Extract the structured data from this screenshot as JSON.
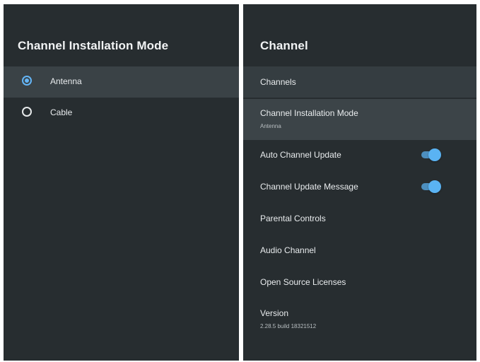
{
  "left_panel": {
    "title": "Channel Installation Mode",
    "options": [
      {
        "label": "Antenna",
        "selected": true
      },
      {
        "label": "Cable",
        "selected": false
      }
    ]
  },
  "right_panel": {
    "title": "Channel",
    "items": [
      {
        "label": "Channels"
      },
      {
        "label": "Channel Installation Mode",
        "value": "Antenna"
      },
      {
        "label": "Auto Channel Update",
        "toggle_on": true
      },
      {
        "label": "Channel Update Message",
        "toggle_on": true
      },
      {
        "label": "Parental Controls"
      },
      {
        "label": "Audio Channel"
      },
      {
        "label": "Open Source Licenses"
      },
      {
        "label": "Version",
        "value": "2.28.5 build 18321512"
      }
    ]
  },
  "colors": {
    "panel_background": "#272d30",
    "row_highlight": "#3a4246",
    "accent": "#64b5f6",
    "toggle_track": "#4d8fbf"
  }
}
